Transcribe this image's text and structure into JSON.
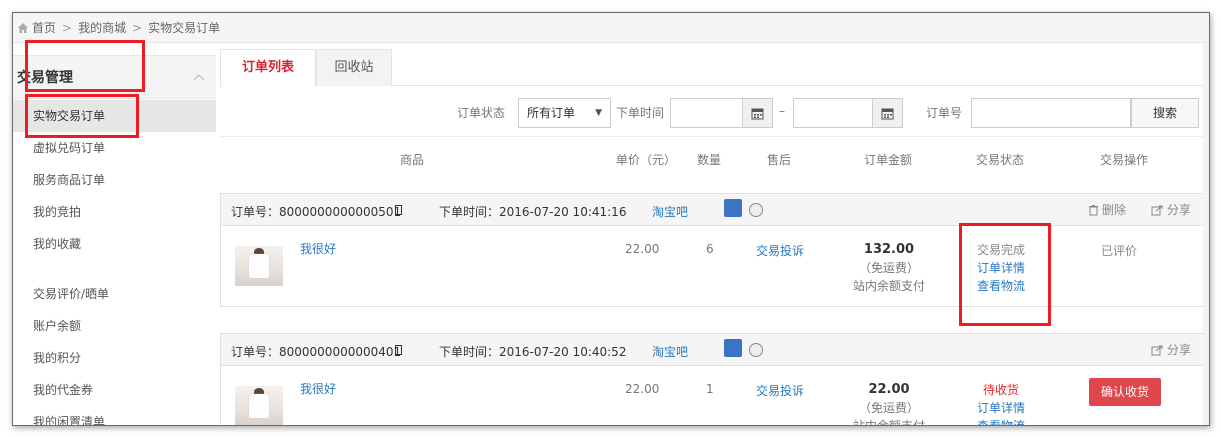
{
  "breadcrumb": {
    "home": "首页",
    "sep1": ">",
    "mall": "我的商城",
    "sep2": ">",
    "current": "实物交易订单"
  },
  "sidebar": {
    "header": "交易管理",
    "items": [
      {
        "label": "实物交易订单"
      },
      {
        "label": "虚拟兑码订单"
      },
      {
        "label": "服务商品订单"
      },
      {
        "label": "我的竞拍"
      },
      {
        "label": "我的收藏"
      }
    ],
    "items2": [
      {
        "label": "交易评价/晒单"
      },
      {
        "label": "账户余额"
      },
      {
        "label": "我的积分"
      },
      {
        "label": "我的代金券"
      },
      {
        "label": "我的闲置清单"
      }
    ]
  },
  "tabs": [
    {
      "label": "订单列表"
    },
    {
      "label": "回收站"
    }
  ],
  "filter": {
    "status_label": "订单状态",
    "status_value": "所有订单",
    "time_label": "下单时间",
    "dash": "–",
    "order_no_label": "订单号",
    "search_button": "搜索"
  },
  "columns": {
    "product": "商品",
    "unit_price": "单价（元）",
    "qty": "数量",
    "after_sale": "售后",
    "amount": "订单金额",
    "trade_status": "交易状态",
    "trade_ops": "交易操作"
  },
  "orders": [
    {
      "order_no": "订单号：8000000000000501",
      "order_time": "下单时间：2016-07-20 10:41:16",
      "shop": "淘宝吧",
      "delete": "删除",
      "share": "分享",
      "product_name": "我很好",
      "price": "22.00",
      "qty": "6",
      "complaint": "交易投诉",
      "amount": "132.00",
      "shipping": "（免运费）",
      "payment": "站内余额支付",
      "status": "交易完成",
      "detail": "订单详情",
      "logistics": "查看物流",
      "op": "已评价"
    },
    {
      "order_no": "订单号：8000000000000401",
      "order_time": "下单时间：2016-07-20 10:40:52",
      "shop": "淘宝吧",
      "share": "分享",
      "product_name": "我很好",
      "price": "22.00",
      "qty": "1",
      "complaint": "交易投诉",
      "amount": "22.00",
      "shipping": "（免运费）",
      "payment": "站内余额支付",
      "status": "待收货",
      "detail": "订单详情",
      "logistics": "查看物流",
      "op_button": "确认收货"
    }
  ],
  "colors": {
    "accent_red": "#d9232e",
    "link_blue": "#2a78c2",
    "highlight_box": "#ee1c25",
    "confirm_button": "#e0474c"
  }
}
